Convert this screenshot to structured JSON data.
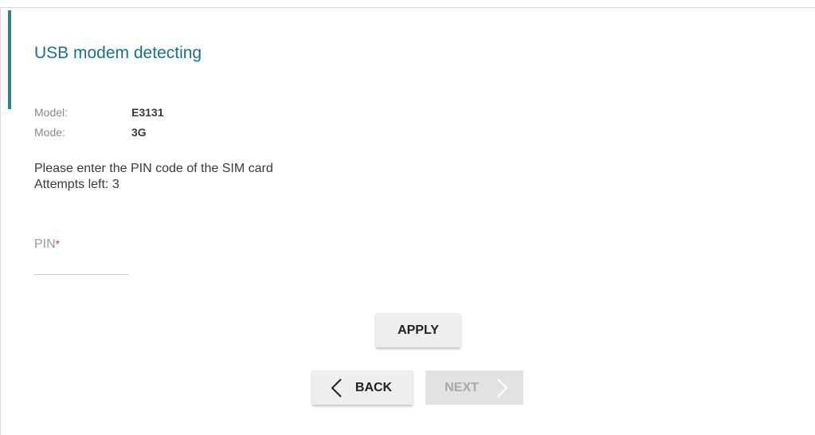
{
  "page": {
    "title": "USB modem detecting"
  },
  "modem_info": {
    "model_label": "Model:",
    "model_value": "E3131",
    "mode_label": "Mode:",
    "mode_value": "3G"
  },
  "message": {
    "line1": "Please enter the PIN code of the SIM card",
    "line2": "Attempts left: 3"
  },
  "pin_field": {
    "label": "PIN",
    "required_mark": "*",
    "value": "",
    "placeholder": ""
  },
  "buttons": {
    "apply_label": "APPLY",
    "back_label": "BACK",
    "next_label": "NEXT"
  },
  "colors": {
    "accent": "#2e7f8f",
    "title": "#1a6f86",
    "required": "#d23a2a",
    "button_bg": "#eeeeee",
    "button_disabled_text": "#a9a9a9"
  }
}
